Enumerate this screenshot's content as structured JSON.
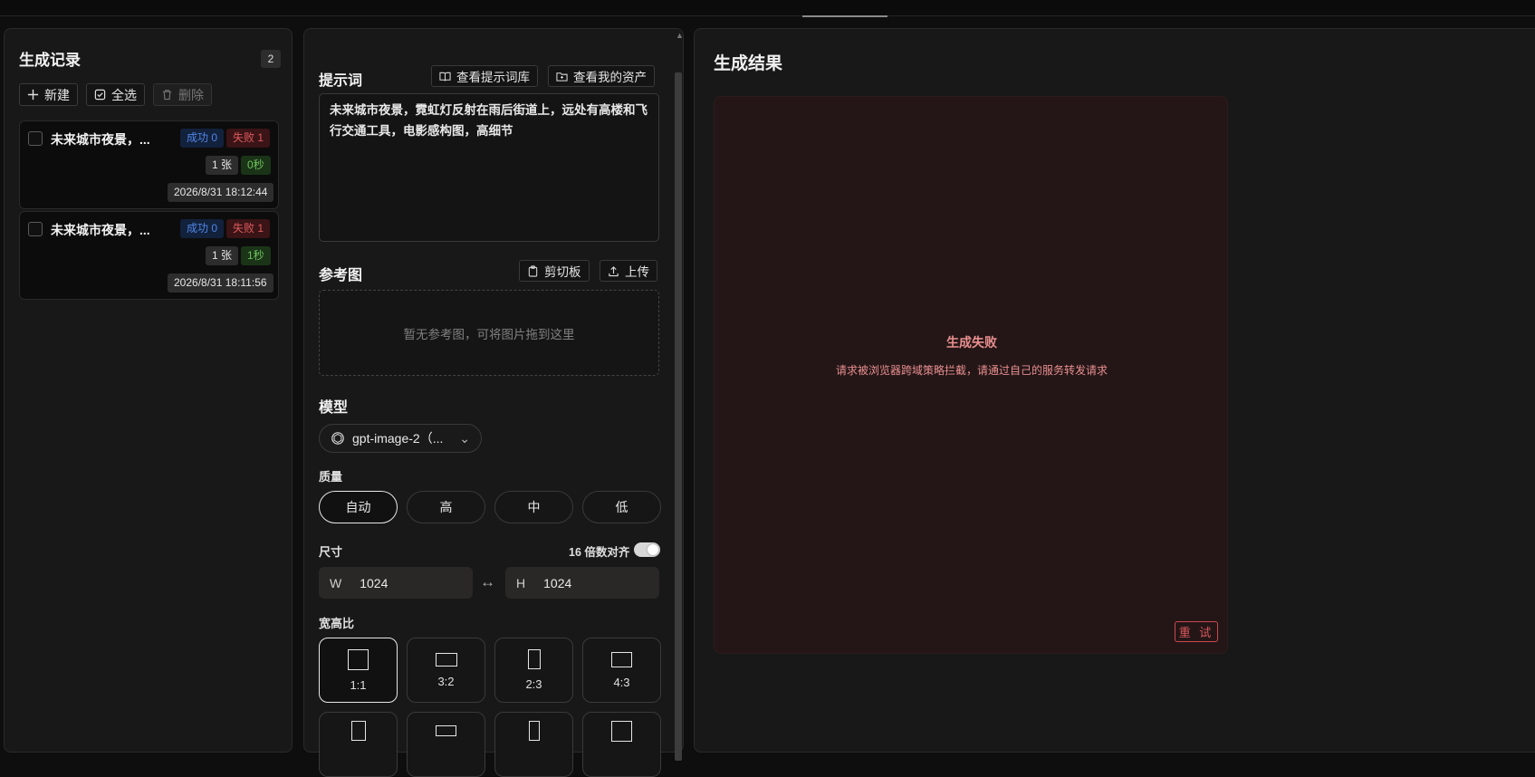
{
  "history": {
    "title": "生成记录",
    "count": "2",
    "actions": {
      "new": "新建",
      "select_all": "全选",
      "delete": "删除"
    },
    "records": [
      {
        "title": "未来城市夜景，...",
        "success": "成功 0",
        "fail": "失败 1",
        "images": "1 张",
        "duration": "0秒",
        "time": "2026/8/31 18:12:44"
      },
      {
        "title": "未来城市夜景，...",
        "success": "成功 0",
        "fail": "失败 1",
        "images": "1 张",
        "duration": "1秒",
        "time": "2026/8/31 18:11:56"
      }
    ]
  },
  "settings": {
    "prompt": {
      "title": "提示词",
      "library_button": "查看提示词库",
      "assets_button": "查看我的资产",
      "value": "未来城市夜景，霓虹灯反射在雨后街道上，远处有高楼和飞行交通工具，电影感构图，高细节"
    },
    "reference": {
      "title": "参考图",
      "clipboard_button": "剪切板",
      "upload_button": "上传",
      "placeholder": "暂无参考图，可将图片拖到这里"
    },
    "model": {
      "title": "模型",
      "selected": "gpt-image-2（..."
    },
    "quality": {
      "title": "质量",
      "options": [
        "自动",
        "高",
        "中",
        "低"
      ],
      "selected": "自动"
    },
    "size": {
      "title": "尺寸",
      "align_label": "16 倍数对齐",
      "align_enabled": true,
      "width_label": "W",
      "width": "1024",
      "height_label": "H",
      "height": "1024"
    },
    "aspect": {
      "title": "宽高比",
      "options": [
        "1:1",
        "3:2",
        "2:3",
        "4:3"
      ],
      "selected": "1:1"
    }
  },
  "results": {
    "title": "生成结果",
    "fail_title": "生成失败",
    "fail_message": "请求被浏览器跨域策略拦截，请通过自己的服务转发请求",
    "retry": "重 试"
  },
  "colors": {
    "background": "#0e0e0e",
    "panel": "#181818",
    "error_text": "#e98f8f",
    "error_card": "#241617",
    "success_tag": "#4f86e6",
    "fail_tag": "#e05a5e",
    "duration_tag": "#6cc25a"
  },
  "icons": [
    "plus-icon",
    "check-square-icon",
    "trash-icon",
    "book-open-icon",
    "folder-icon",
    "clipboard-icon",
    "upload-icon",
    "openai-icon",
    "chevron-down-icon",
    "swap-icon"
  ]
}
